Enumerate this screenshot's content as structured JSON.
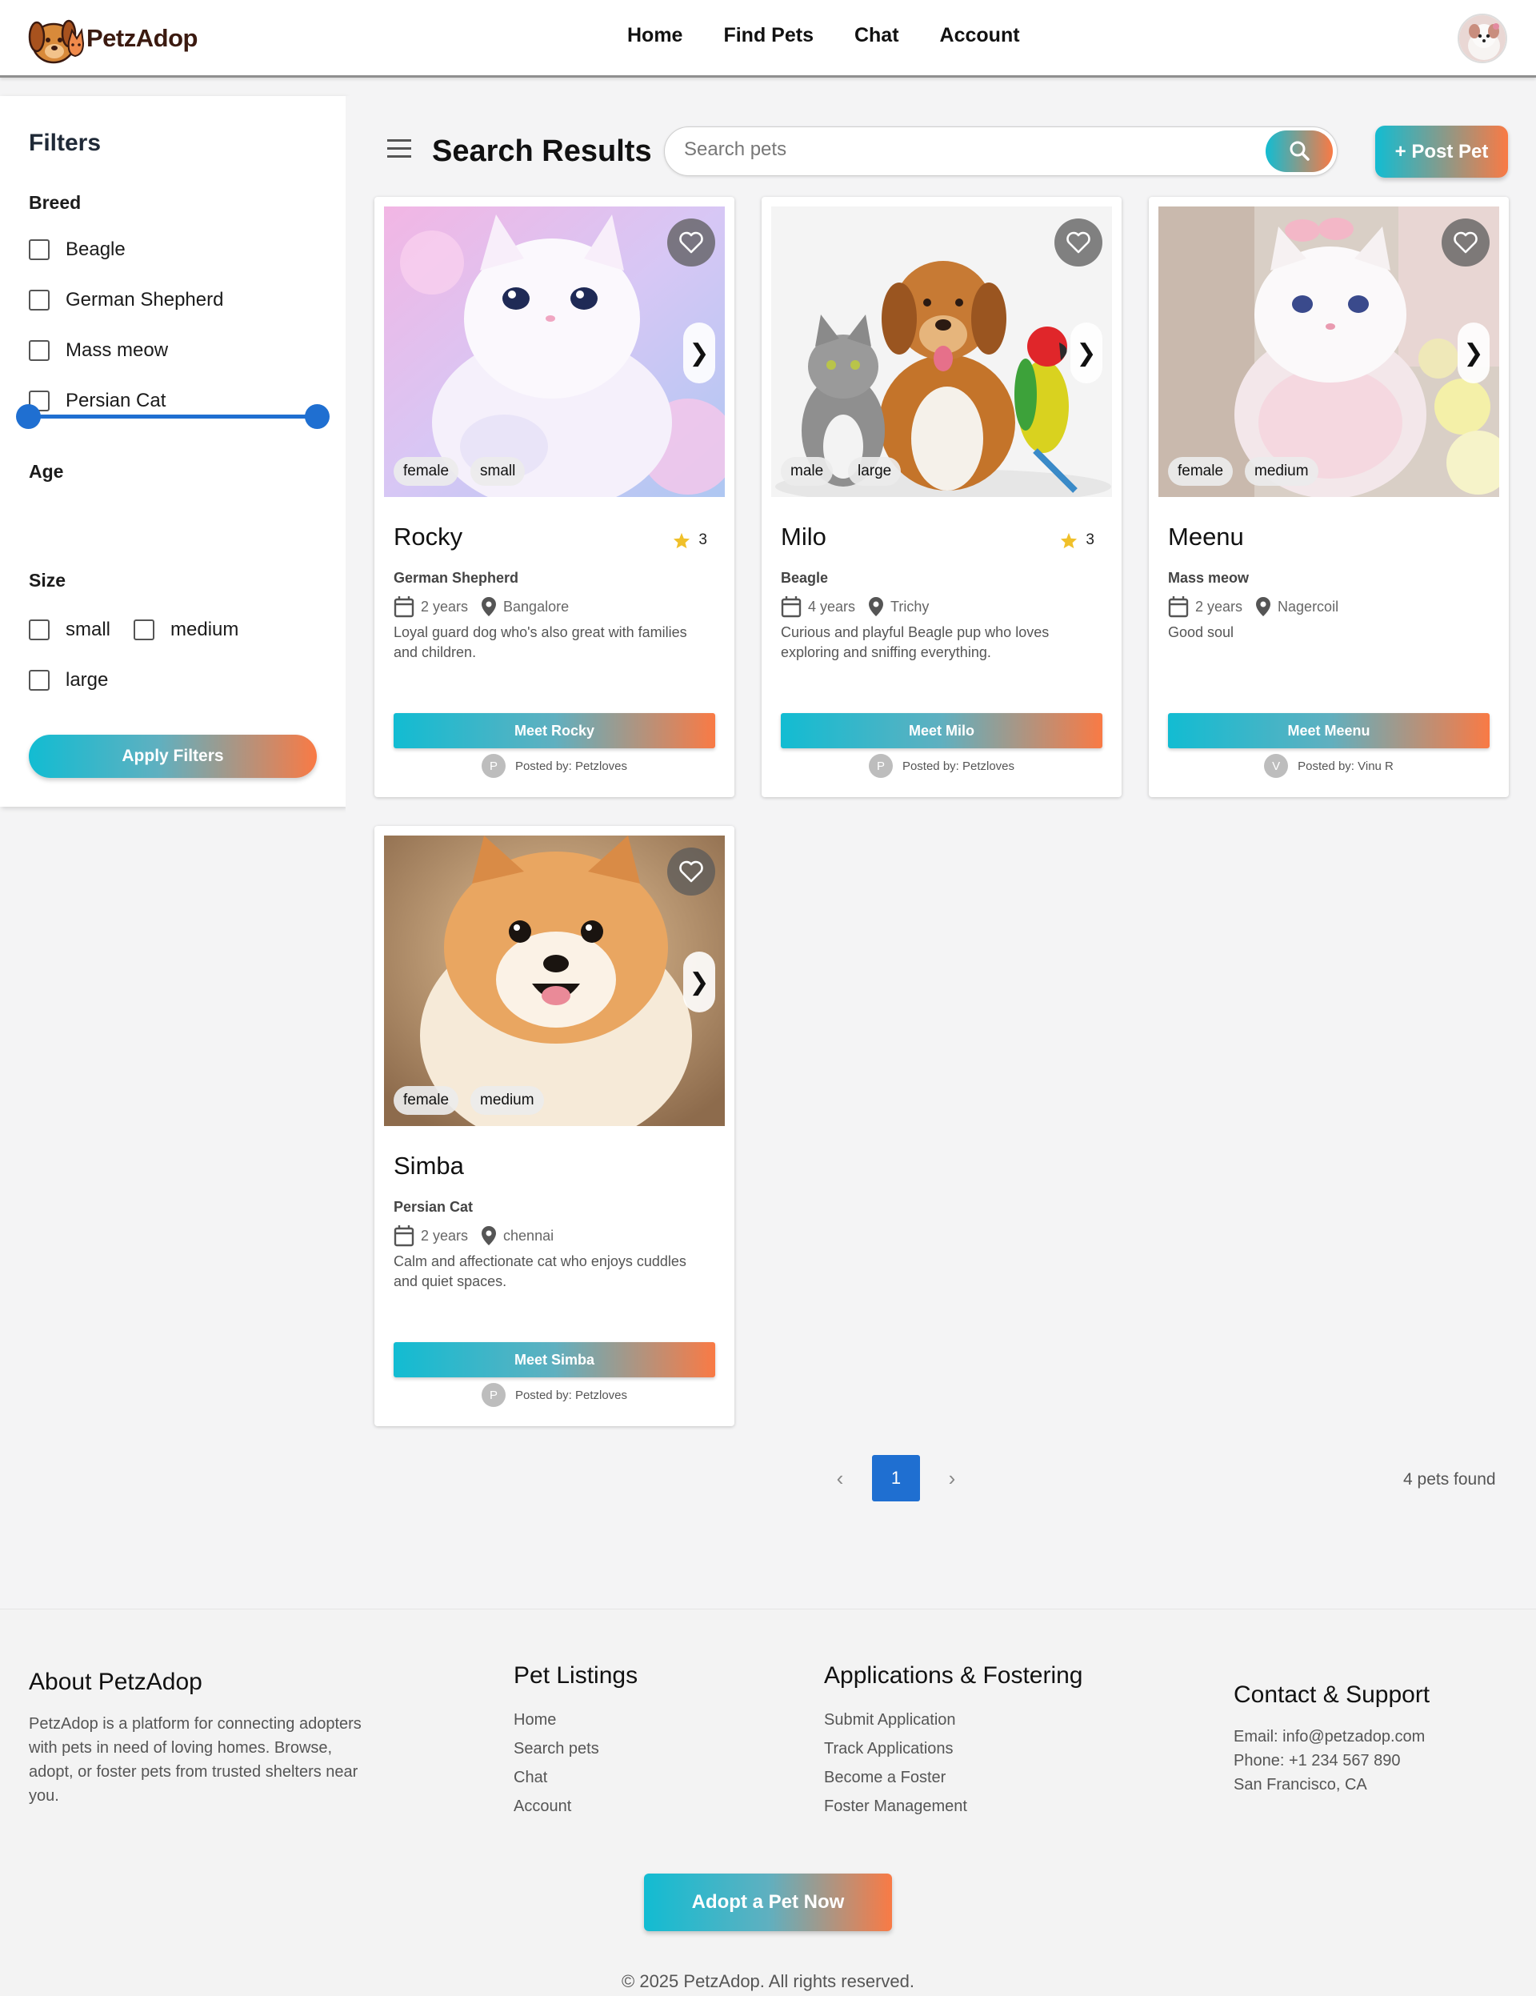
{
  "brand": {
    "name": "PetzAdop"
  },
  "nav": {
    "items": [
      "Home",
      "Find Pets",
      "Chat",
      "Account"
    ]
  },
  "sidebar": {
    "title": "Filters",
    "breed_label": "Breed",
    "breeds": [
      "Beagle",
      "German Shepherd",
      "Mass meow",
      "Persian Cat"
    ],
    "age_label": "Age",
    "size_label": "Size",
    "sizes": [
      "small",
      "medium",
      "large"
    ],
    "apply_label": "Apply Filters"
  },
  "main": {
    "title": "Search Results",
    "search_placeholder": "Search pets",
    "post_label": "+ Post Pet",
    "pets": [
      {
        "name": "Rocky",
        "rating": "3",
        "breed": "German Shepherd",
        "age": "2 years",
        "location": "Bangalore",
        "description": "Loyal guard dog who's also great with families and children.",
        "tags": [
          "female",
          "small"
        ],
        "meet_label": "Meet Rocky",
        "poster_initial": "P",
        "posted_by": "Posted by: Petzloves"
      },
      {
        "name": "Milo",
        "rating": "3",
        "breed": "Beagle",
        "age": "4 years",
        "location": "Trichy",
        "description": "Curious and playful Beagle pup who loves exploring and sniffing everything.",
        "tags": [
          "male",
          "large"
        ],
        "meet_label": "Meet Milo",
        "poster_initial": "P",
        "posted_by": "Posted by: Petzloves"
      },
      {
        "name": "Meenu",
        "rating": "",
        "breed": "Mass meow",
        "age": "2 years",
        "location": "Nagercoil",
        "description": "Good soul",
        "tags": [
          "female",
          "medium"
        ],
        "meet_label": "Meet Meenu",
        "poster_initial": "V",
        "posted_by": "Posted by: Vinu R"
      },
      {
        "name": "Simba",
        "rating": "",
        "breed": "Persian Cat",
        "age": "2 years",
        "location": "chennai",
        "description": "Calm and affectionate cat who enjoys cuddles and quiet spaces.",
        "tags": [
          "female",
          "medium"
        ],
        "meet_label": "Meet Simba",
        "poster_initial": "P",
        "posted_by": "Posted by: Petzloves"
      }
    ],
    "pagination": {
      "current": "1",
      "prev_icon": "‹",
      "next_icon": "›"
    },
    "found_text": "4 pets found"
  },
  "footer": {
    "about_title": "About PetzAdop",
    "about_text": "PetzAdop is a platform for connecting adopters with pets in need of loving homes. Browse, adopt, or foster pets from trusted shelters near you.",
    "listings_title": "Pet Listings",
    "listings": [
      "Home",
      "Search pets",
      "Chat",
      "Account"
    ],
    "apps_title": "Applications & Fostering",
    "apps": [
      "Submit Application",
      "Track Applications",
      "Become a Foster",
      "Foster Management"
    ],
    "contact_title": "Contact & Support",
    "contact": [
      "Email: info@petzadop.com",
      "Phone: +1 234 567 890",
      "San Francisco, CA"
    ],
    "adopt_label": "Adopt a Pet Now",
    "copyright": "© 2025 PetzAdop. All rights reserved."
  },
  "colors": {
    "accent_start": "#12bcd2",
    "accent_end": "#f97a45",
    "primary": "#1f6fd1"
  },
  "icons": [
    "menu-icon",
    "search-icon",
    "heart-icon",
    "chevron-right-icon",
    "star-icon",
    "calendar-icon",
    "location-icon"
  ]
}
